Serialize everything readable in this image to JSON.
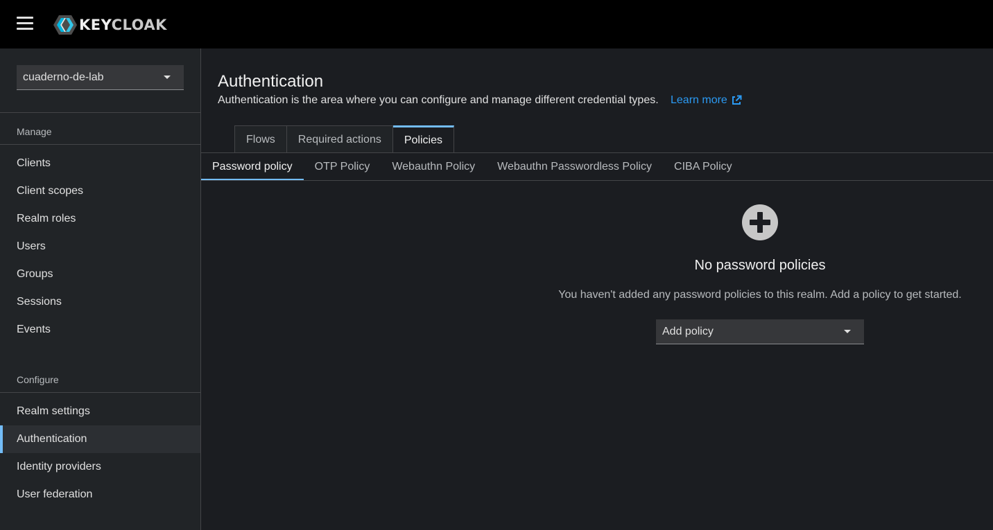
{
  "header": {
    "logo_key": "KEY",
    "logo_cloak": "CLOAK",
    "menu_icon": "hamburger-icon"
  },
  "sidebar": {
    "realm": "cuaderno-de-lab",
    "manage_title": "Manage",
    "manage_items": [
      "Clients",
      "Client scopes",
      "Realm roles",
      "Users",
      "Groups",
      "Sessions",
      "Events"
    ],
    "configure_title": "Configure",
    "configure_items": [
      "Realm settings",
      "Authentication",
      "Identity providers",
      "User federation"
    ],
    "active_item": "Authentication"
  },
  "main": {
    "title": "Authentication",
    "description": "Authentication is the area where you can configure and manage different credential types.",
    "learn_more": "Learn more",
    "tabs": [
      "Flows",
      "Required actions",
      "Policies"
    ],
    "active_tab": "Policies",
    "subtabs": [
      "Password policy",
      "OTP Policy",
      "Webauthn Policy",
      "Webauthn Passwordless Policy",
      "CIBA Policy"
    ],
    "active_subtab": "Password policy",
    "empty_state": {
      "icon": "plus-circle-icon",
      "title": "No password policies",
      "body": "You haven't added any password policies to this realm. Add a policy to get started.",
      "select_label": "Add policy"
    }
  },
  "colors": {
    "accent": "#73bcf7",
    "link": "#2b9af3",
    "background": "#1b1d21",
    "sidebar": "#212427",
    "masthead": "#000000"
  }
}
